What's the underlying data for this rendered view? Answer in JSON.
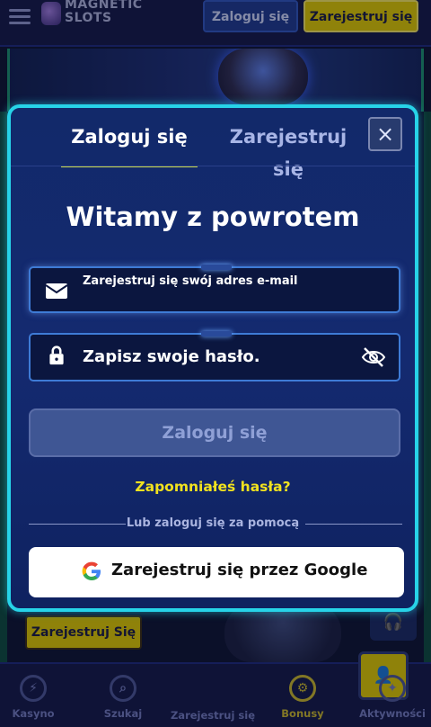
{
  "topbar": {
    "logo_line1": "MAGNETIC",
    "logo_line2": "SLOTS",
    "login_label": "Zaloguj się",
    "register_label": "Zarejestruj się"
  },
  "background": {
    "register_label": "Zarejestruj Się"
  },
  "bottom_nav": {
    "items": [
      {
        "label": "Kasyno",
        "icon": "lightning-icon"
      },
      {
        "label": "Szukaj",
        "icon": "search-icon"
      },
      {
        "label": "Zarejestruj się",
        "icon": "user-icon"
      },
      {
        "label": "Bonusy",
        "icon": "gear-icon"
      },
      {
        "label": "Aktywności",
        "icon": "activity-icon"
      }
    ]
  },
  "modal": {
    "tabs": {
      "login": "Zaloguj się",
      "register": "Zarejestruj się"
    },
    "close_symbol": "×",
    "heading": "Witamy z powrotem",
    "email_placeholder": "Zarejestruj się swój adres e-mail",
    "password_placeholder": "Zapisz swoje hasło.",
    "submit_label": "Zaloguj się",
    "forgot_label": "Zapomniałeś hasła?",
    "divider_label": "Lub zaloguj się za pomocą",
    "google_label": "Zarejestruj się przez Google"
  },
  "colors": {
    "accent_border": "#27d3e8",
    "cta_yellow": "#d8c300",
    "link_yellow": "#f1e21f",
    "modal_bg": "#12296a"
  }
}
